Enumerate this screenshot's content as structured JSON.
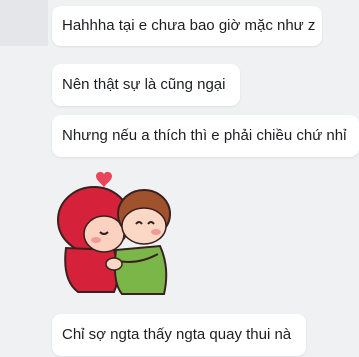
{
  "messages": [
    {
      "text": "Hahhha tại e chưa bao giờ mặc như z"
    },
    {
      "text": "Nên thật sự là cũng ngại"
    },
    {
      "text": "Nhưng nếu a thích thì e phải chiều chứ nhỉ"
    },
    {
      "text": "Chỉ sợ ngta thấy ngta quay thui nà"
    }
  ],
  "sticker": {
    "icon": "hugging-couple-sticker"
  },
  "colors": {
    "background": "#f0f1f3",
    "bubble": "#ffffff",
    "text": "#1c1e21",
    "heart": "#e8465a"
  }
}
